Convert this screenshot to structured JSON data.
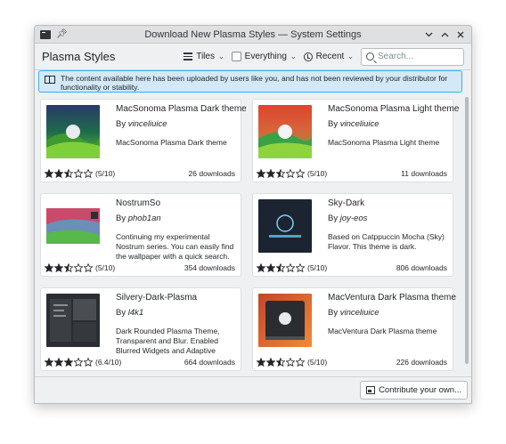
{
  "window": {
    "title": "Download New Plasma Styles — System Settings",
    "controls": [
      "chevron-down-icon",
      "chevron-up-icon",
      "close-icon"
    ]
  },
  "toolbar": {
    "heading": "Plasma Styles",
    "view_label": "Tiles",
    "filter_label": "Everything",
    "sort_label": "Recent",
    "search_placeholder": "Search..."
  },
  "notice": {
    "text": "The content available here has been uploaded by users like you, and has not been reviewed by your distributor for functionality or stability."
  },
  "cards": [
    {
      "name": "MacSonoma Plasma Dark theme",
      "by": "By ",
      "author": "vinceliuice",
      "description": "MacSonoma Plasma Dark theme",
      "rating_text": "(5/10)",
      "stars": 2.5,
      "downloads": "26 downloads",
      "thumb": "sonoma-dark"
    },
    {
      "name": "MacSonoma Plasma Light theme",
      "by": "By ",
      "author": "vinceliuice",
      "description": "MacSonoma Plasma Light theme",
      "rating_text": "(5/10)",
      "stars": 2.5,
      "downloads": "11 downloads",
      "thumb": "sonoma-light"
    },
    {
      "name": "NostrumSo",
      "by": "By ",
      "author": "phob1an",
      "description": "Continuing my experimental Nostrum series. You can easily find the wallpaper with a quick search. No GI...",
      "rating_text": "(5/10)",
      "stars": 2.5,
      "downloads": "354 downloads",
      "thumb": "nostrum"
    },
    {
      "name": "Sky-Dark",
      "by": "By ",
      "author": "joy-eos",
      "description": "Based on Catppuccin Mocha (Sky) Flavor. This theme is dark.",
      "rating_text": "(5/10)",
      "stars": 2.5,
      "downloads": "806 downloads",
      "thumb": "sky-dark"
    },
    {
      "name": "Silvery-Dark-Plasma",
      "by": "By ",
      "author": "l4k1",
      "description": "Dark Rounded Plasma Theme, Transparent and Blur. Enabled Blurred Widgets and Adaptive Tran...",
      "rating_text": "(6.4/10)",
      "stars": 3,
      "downloads": "664 downloads",
      "thumb": "silvery"
    },
    {
      "name": "MacVentura Dark Plasma theme",
      "by": "By ",
      "author": "vinceliuice",
      "description": "MacVentura Dark Plasma theme",
      "rating_text": "(5/10)",
      "stars": 2.5,
      "downloads": "226 downloads",
      "thumb": "ventura"
    }
  ],
  "bottom": {
    "contribute_label": "Contribute your own..."
  },
  "colors": {
    "accent": "#3daee9",
    "notice_bg": "#d3e9f7",
    "star": "#232629"
  }
}
